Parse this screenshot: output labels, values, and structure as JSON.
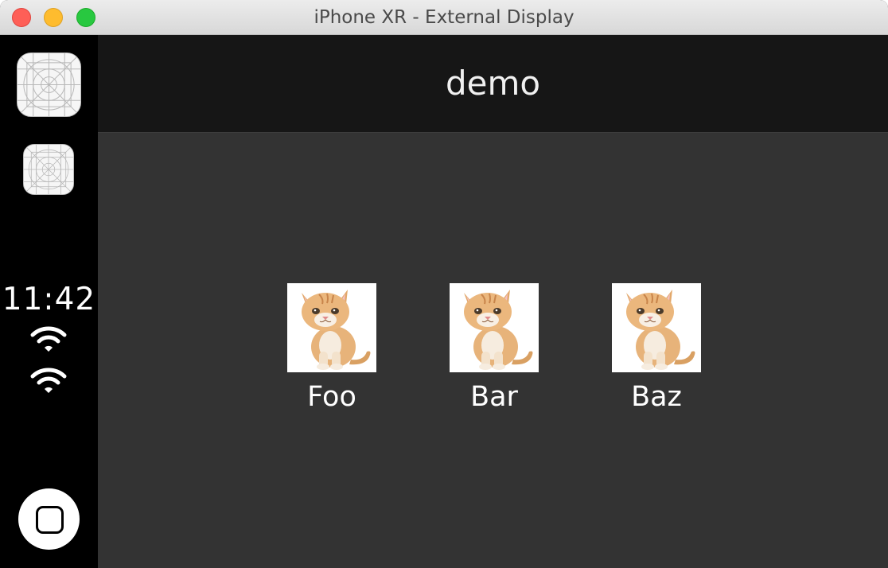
{
  "window": {
    "title": "iPhone XR - External Display",
    "controls": {
      "close": "close-button",
      "minimize": "minimize-button",
      "maximize": "zoom-button"
    },
    "colors": {
      "close": "#fe5f57",
      "minimize": "#febc2e",
      "maximize": "#28c840"
    }
  },
  "sidebar": {
    "apps": [
      {
        "name": "app-placeholder-icon"
      },
      {
        "name": "app-placeholder-icon"
      }
    ],
    "time": "11:42",
    "status_icons": [
      "wifi-icon",
      "wifi-icon"
    ],
    "home_button_icon": "home-square-icon"
  },
  "navbar": {
    "title": "demo"
  },
  "grid": {
    "items": [
      {
        "label": "Foo",
        "image": "kitten-image"
      },
      {
        "label": "Bar",
        "image": "kitten-image"
      },
      {
        "label": "Baz",
        "image": "kitten-image"
      }
    ]
  },
  "colors": {
    "navbar_bg": "#161616",
    "content_bg": "#333333",
    "sidebar_bg": "#000000",
    "text": "#ffffff"
  }
}
